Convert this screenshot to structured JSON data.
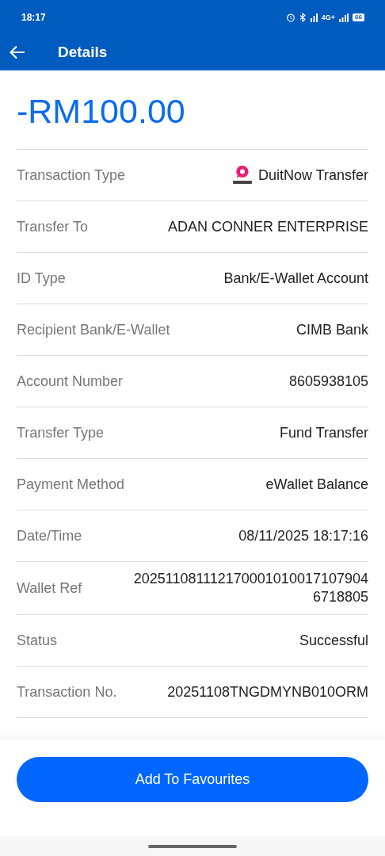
{
  "status_bar": {
    "time": "18:17",
    "network": "4G+",
    "battery": "66"
  },
  "header": {
    "title": "Details"
  },
  "amount": "-RM100.00",
  "details": [
    {
      "label": "Transaction Type",
      "value": "DuitNow Transfer",
      "kind": "duitnow"
    },
    {
      "label": "Transfer To",
      "value": "ADAN CONNER ENTERPRISE",
      "kind": "text"
    },
    {
      "label": "ID Type",
      "value": "Bank/E-Wallet Account",
      "kind": "text"
    },
    {
      "label": "Recipient Bank/E-Wallet",
      "value": "CIMB Bank",
      "kind": "text"
    },
    {
      "label": "Account Number",
      "value": "8605938105",
      "kind": "text"
    },
    {
      "label": "Transfer Type",
      "value": "Fund Transfer",
      "kind": "text"
    },
    {
      "label": "Payment Method",
      "value": "eWallet Balance",
      "kind": "text"
    },
    {
      "label": "Date/Time",
      "value": "08/11/2025 18:17:16",
      "kind": "text"
    },
    {
      "label": "Wallet Ref",
      "value": "2025110811121700010100171079046718805",
      "kind": "long"
    },
    {
      "label": "Status",
      "value": "Successful",
      "kind": "text"
    },
    {
      "label": "Transaction No.",
      "value": "20251108TNGDMYNB010ORM",
      "kind": "long"
    }
  ],
  "footer_button": "Add To Favourites"
}
